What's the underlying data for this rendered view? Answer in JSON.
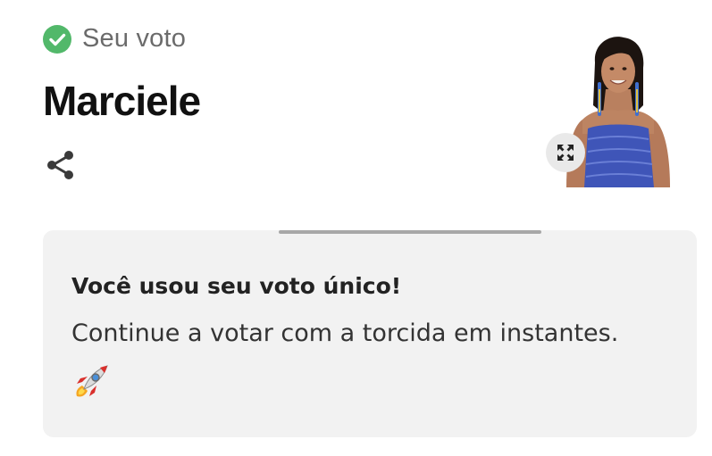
{
  "vote": {
    "status_label": "Seu voto",
    "status_icon": "check-circle-icon",
    "status_color": "#4caf50"
  },
  "candidate": {
    "name": "Marciele",
    "photo_alt": "Marciele"
  },
  "actions": {
    "share_icon": "share-icon",
    "expand_icon": "expand-icon"
  },
  "card": {
    "title": "Você usou seu voto único!",
    "message": "Continue a votar com a torcida em instantes.",
    "emoji_icon": "rocket-icon"
  },
  "colors": {
    "background": "#ffffff",
    "card_background": "#f2f2f2",
    "muted_text": "#6b6b6b",
    "dress": "#3f55b8"
  }
}
